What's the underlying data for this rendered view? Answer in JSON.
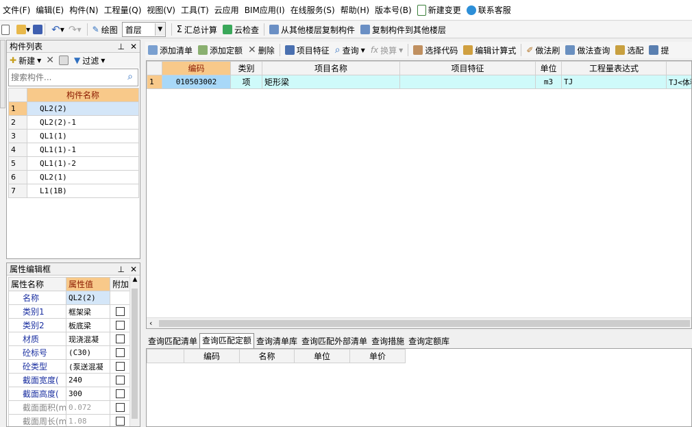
{
  "menu": [
    {
      "label": "文件(F)",
      "name": "menu-file"
    },
    {
      "label": "编辑(E)",
      "name": "menu-edit"
    },
    {
      "label": "构件(N)",
      "name": "menu-component"
    },
    {
      "label": "工程量(Q)",
      "name": "menu-quantity"
    },
    {
      "label": "视图(V)",
      "name": "menu-view"
    },
    {
      "label": "工具(T)",
      "name": "menu-tools"
    },
    {
      "label": "云应用",
      "name": "menu-cloud"
    },
    {
      "label": "BIM应用(I)",
      "name": "menu-bim"
    },
    {
      "label": "在线服务(S)",
      "name": "menu-online"
    },
    {
      "label": "帮助(H)",
      "name": "menu-help"
    },
    {
      "label": "版本号(B)",
      "name": "menu-version"
    }
  ],
  "menu_extra": {
    "new_change": "新建变更",
    "contact": "联系客服"
  },
  "toolbar2": {
    "draw": "绘图",
    "floor": "首层",
    "sum": "汇总计算",
    "cloud_check": "云检查",
    "copy_from": "从其他楼层复制构件",
    "copy_to": "复制构件到其他楼层"
  },
  "component_list": {
    "title": "构件列表",
    "new": "新建",
    "filter": "过滤",
    "search_placeholder": "搜索构件...",
    "column": "构件名称",
    "rows": [
      {
        "n": "1",
        "name": "QL2(2)"
      },
      {
        "n": "2",
        "name": "QL2(2)-1"
      },
      {
        "n": "3",
        "name": "QL1(1)"
      },
      {
        "n": "4",
        "name": "QL1(1)-1"
      },
      {
        "n": "5",
        "name": "QL1(1)-2"
      },
      {
        "n": "6",
        "name": "QL2(1)"
      },
      {
        "n": "7",
        "name": "L1(1B)"
      }
    ]
  },
  "property_editor": {
    "title": "属性编辑框",
    "col_name": "属性名称",
    "col_value": "属性值",
    "col_extra": "附加",
    "rows": [
      {
        "name": "名称",
        "value": "QL2(2)",
        "checkbox": false,
        "muted": false
      },
      {
        "name": "类别1",
        "value": "框架梁",
        "checkbox": true,
        "muted": false
      },
      {
        "name": "类别2",
        "value": "板底梁",
        "checkbox": true,
        "muted": false
      },
      {
        "name": "材质",
        "value": "现浇混凝",
        "checkbox": true,
        "muted": false
      },
      {
        "name": "砼标号",
        "value": "(C30)",
        "checkbox": true,
        "muted": false
      },
      {
        "name": "砼类型",
        "value": "(泵送混凝",
        "checkbox": true,
        "muted": false
      },
      {
        "name": "截面宽度(",
        "value": "240",
        "checkbox": true,
        "muted": false
      },
      {
        "name": "截面高度(",
        "value": "300",
        "checkbox": true,
        "muted": false
      },
      {
        "name": "截面面积(m",
        "value": "0.072",
        "checkbox": true,
        "muted": true
      },
      {
        "name": "截面周长(m",
        "value": "1.08",
        "checkbox": true,
        "muted": true
      }
    ]
  },
  "toolbar3": {
    "add_bill": "添加清单",
    "add_quota": "添加定额",
    "delete": "删除",
    "feature": "项目特征",
    "query": "查询",
    "convert": "换算",
    "select_code": "选择代码",
    "edit_formula": "编辑计算式",
    "method_brush": "做法刷",
    "method_query": "做法查询",
    "match": "选配",
    "extract": "提"
  },
  "main_table": {
    "columns": [
      "编码",
      "类别",
      "项目名称",
      "项目特征",
      "单位",
      "工程量表达式"
    ],
    "rows": [
      {
        "n": "1",
        "code": "010503002",
        "type": "项",
        "name": "矩形梁",
        "feature": "",
        "unit": "m3",
        "expr": "TJ",
        "extra": "TJ<体积"
      }
    ]
  },
  "bottom_tabs": [
    "查询匹配清单",
    "查询匹配定额",
    "查询清单库",
    "查询匹配外部清单",
    "查询措施",
    "查询定额库"
  ],
  "bottom_table": {
    "columns": [
      "编码",
      "名称",
      "单位",
      "单价"
    ]
  }
}
